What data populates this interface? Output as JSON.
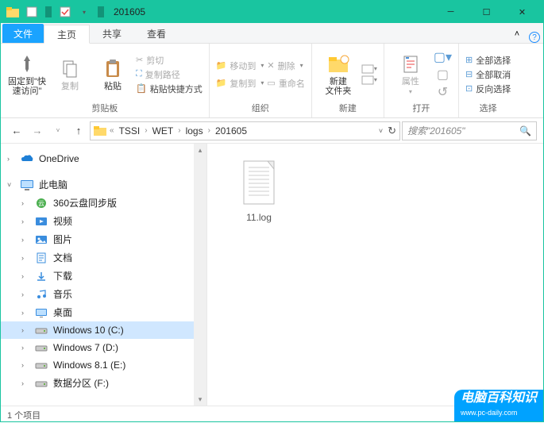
{
  "window": {
    "title": "201605"
  },
  "tabs": {
    "file": "文件",
    "home": "主页",
    "share": "共享",
    "view": "查看"
  },
  "ribbon": {
    "clipboard": {
      "pin": "固定到\"快\n速访问\"",
      "copy": "复制",
      "paste": "粘贴",
      "cut": "剪切",
      "copy_path": "复制路径",
      "paste_shortcut": "粘贴快捷方式",
      "group": "剪贴板"
    },
    "organize": {
      "move_to": "移动到",
      "copy_to": "复制到",
      "delete": "删除",
      "rename": "重命名",
      "group": "组织"
    },
    "new_": {
      "new_folder": "新建\n文件夹",
      "group": "新建"
    },
    "open": {
      "properties": "属性",
      "group": "打开"
    },
    "select": {
      "select_all": "全部选择",
      "select_none": "全部取消",
      "invert": "反向选择",
      "group": "选择"
    }
  },
  "breadcrumb": {
    "items": [
      "TSSI",
      "WET",
      "logs",
      "201605"
    ]
  },
  "navbar": {
    "refresh": "↻"
  },
  "search": {
    "placeholder": "搜索\"201605\""
  },
  "tree": {
    "onedrive": "OneDrive",
    "this_pc": "此电脑",
    "items": [
      {
        "icon": "cloud360",
        "label": "360云盘同步版"
      },
      {
        "icon": "video",
        "label": "视频"
      },
      {
        "icon": "pictures",
        "label": "图片"
      },
      {
        "icon": "documents",
        "label": "文档"
      },
      {
        "icon": "downloads",
        "label": "下载"
      },
      {
        "icon": "music",
        "label": "音乐"
      },
      {
        "icon": "desktop",
        "label": "桌面"
      },
      {
        "icon": "drive",
        "label": "Windows 10 (C:)",
        "selected": true
      },
      {
        "icon": "drive",
        "label": "Windows 7 (D:)"
      },
      {
        "icon": "drive",
        "label": "Windows 8.1 (E:)"
      },
      {
        "icon": "drive",
        "label": "数据分区 (F:)"
      }
    ]
  },
  "files": [
    {
      "name": "11.log",
      "type": "text"
    }
  ],
  "status": {
    "count": "1 个项目"
  },
  "watermark": {
    "brand": "电脑百科知识",
    "url": "www.pc-daily.com"
  }
}
